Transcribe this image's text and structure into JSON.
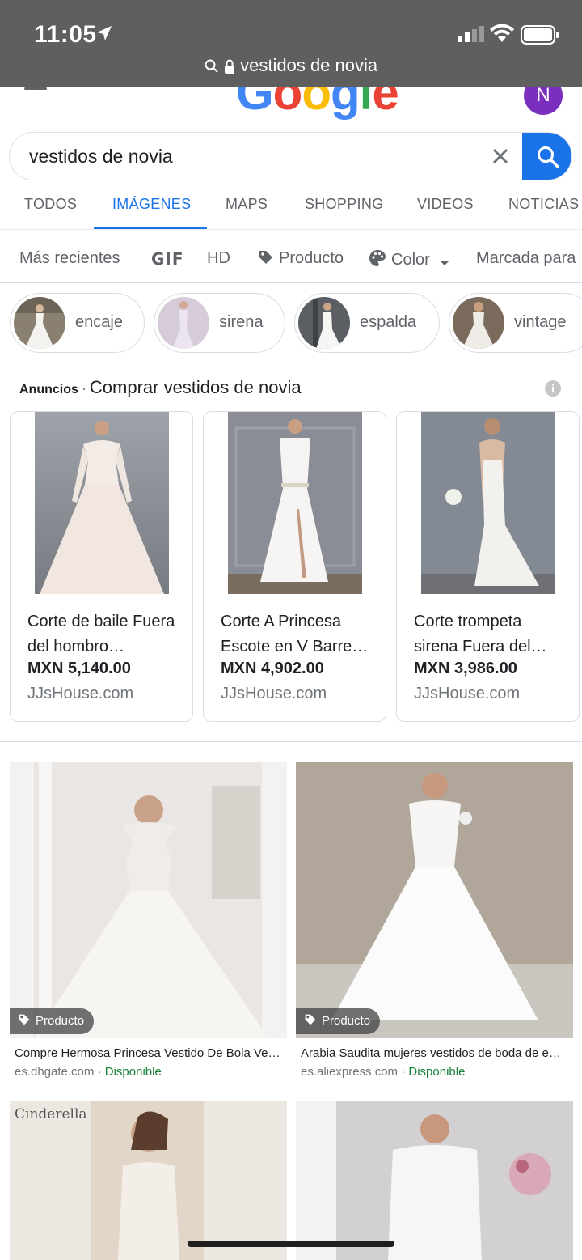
{
  "status_bar": {
    "time": "11:05",
    "url": "vestidos de novia"
  },
  "header": {
    "logo": [
      "G",
      "o",
      "o",
      "g",
      "l",
      "e"
    ],
    "avatar_letter": "N"
  },
  "search": {
    "query": "vestidos de novia"
  },
  "tabs": [
    {
      "label": "TODOS"
    },
    {
      "label": "IMÁGENES"
    },
    {
      "label": "MAPS"
    },
    {
      "label": "SHOPPING"
    },
    {
      "label": "VIDEOS"
    },
    {
      "label": "NOTICIAS"
    }
  ],
  "filters": {
    "recent": "Más recientes",
    "gif": "GIF",
    "hd": "HD",
    "product": "Producto",
    "color": "Color",
    "license": "Marcada para"
  },
  "suggestions": [
    "encaje",
    "sirena",
    "espalda",
    "vintage"
  ],
  "ads": {
    "label": "Anuncios",
    "heading": "Comprar vestidos de novia",
    "items": [
      {
        "name": "Corte de baile Fuera del hombro…",
        "price": "MXN 5,140.00",
        "store": "JJsHouse.com"
      },
      {
        "name": "Corte A Princesa Escote en V Barre…",
        "price": "MXN 4,902.00",
        "store": "JJsHouse.com"
      },
      {
        "name": "Corte trompeta sirena Fuera del…",
        "price": "MXN 3,986.00",
        "store": "JJsHouse.com"
      }
    ]
  },
  "results": [
    {
      "badge": "Producto",
      "title": "Compre Hermosa Princesa Vestido De Bola Ve…",
      "source": "es.dhgate.com",
      "availability": "Disponible"
    },
    {
      "badge": "Producto",
      "title": "Arabia Saudita mujeres vestidos de boda de e…",
      "source": "es.aliexpress.com",
      "availability": "Disponible"
    },
    {
      "overlay_text": "Cinderella"
    },
    {}
  ],
  "colors": {
    "accent": "#1a73e8",
    "status_bar": "#5f5f5f",
    "available": "#188038"
  }
}
